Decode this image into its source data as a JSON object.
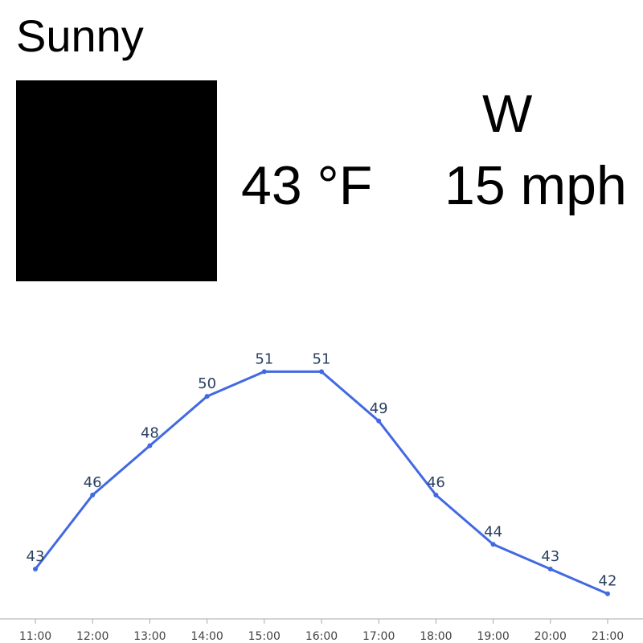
{
  "current": {
    "condition": "Sunny",
    "temperature": "43 °F",
    "wind_direction": "W",
    "wind_speed": "15 mph"
  },
  "colors": {
    "line": "#4169e1",
    "label": "#2a3f5f",
    "axis": "#aaaaaa",
    "tick_text": "#444444",
    "image_placeholder": "#000000"
  },
  "chart_data": {
    "type": "line",
    "categories": [
      "11:00",
      "12:00",
      "13:00",
      "14:00",
      "15:00",
      "16:00",
      "17:00",
      "18:00",
      "19:00",
      "20:00",
      "21:00"
    ],
    "values": [
      43,
      46,
      48,
      50,
      51,
      51,
      49,
      46,
      44,
      43,
      42
    ],
    "data_labels": true,
    "y_axis_visible": false,
    "grid": false
  }
}
